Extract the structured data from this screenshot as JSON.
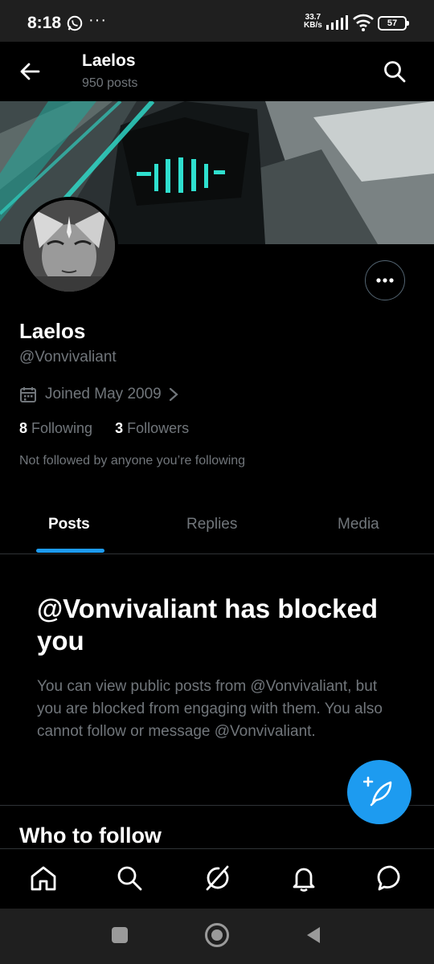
{
  "status_bar": {
    "time": "8:18",
    "dots": "···",
    "net_speed_value": "33.7",
    "net_speed_unit": "KB/s",
    "battery": "57",
    "icons": [
      "whatsapp-icon",
      "signal-icon",
      "wifi-icon",
      "battery-icon"
    ]
  },
  "header": {
    "title": "Laelos",
    "posts_count": "950 posts"
  },
  "profile": {
    "name": "Laelos",
    "handle": "@Vonvivaliant",
    "joined": "Joined May 2009",
    "following_count": "8",
    "following_label": "Following",
    "followers_count": "3",
    "followers_label": "Followers",
    "mutual_note": "Not followed by anyone you’re following"
  },
  "tabs": [
    {
      "label": "Posts",
      "active": true
    },
    {
      "label": "Replies",
      "active": false
    },
    {
      "label": "Media",
      "active": false
    }
  ],
  "blocked": {
    "title": "@Vonvivaliant has blocked you",
    "body": "You can view public posts from @Vonvivaliant, but you are blocked from engaging with them. You also cannot follow or message @Vonvivaliant."
  },
  "who_to_follow": "Who to follow",
  "colors": {
    "accent": "#1d9bf0",
    "background": "#000000",
    "secondary_text": "#71767b",
    "divider": "#2f3336"
  },
  "bottom_nav": [
    "home-icon",
    "search-icon",
    "grok-icon",
    "notifications-icon",
    "messages-icon"
  ],
  "system_nav": [
    "recents-button",
    "home-button",
    "back-button"
  ]
}
